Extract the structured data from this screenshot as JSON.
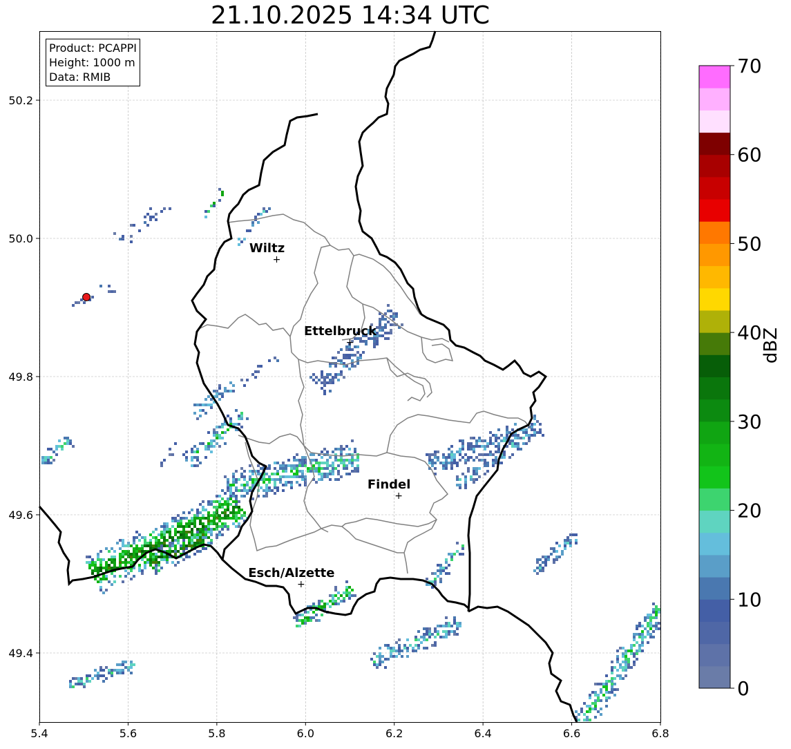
{
  "title": "21.10.2025 14:34 UTC",
  "info_box": {
    "product": "Product: PCAPPI",
    "height": "Height: 1000 m",
    "data": "Data: RMIB"
  },
  "axes": {
    "x_ticks": [
      "5.4",
      "5.6",
      "5.8",
      "6.0",
      "6.2",
      "6.4",
      "6.6",
      "6.8"
    ],
    "y_ticks": [
      "50.2",
      "50.0",
      "49.8",
      "49.6",
      "49.4"
    ],
    "xlim": [
      5.4,
      6.8
    ],
    "ylim": [
      49.3,
      50.3
    ],
    "grid": true
  },
  "cities": [
    {
      "name": "Wiltz",
      "lon": 5.935,
      "lat": 49.97
    },
    {
      "name": "Ettelbruck",
      "lon": 6.1,
      "lat": 49.85
    },
    {
      "name": "Findel",
      "lon": 6.21,
      "lat": 49.628
    },
    {
      "name": "Esch/Alzette",
      "lon": 5.99,
      "lat": 49.5
    }
  ],
  "radar_site": {
    "lon": 5.506,
    "lat": 49.915,
    "color": "#e8191c"
  },
  "colorbar": {
    "label": "dBZ",
    "ticks": [
      "0",
      "10",
      "20",
      "30",
      "40",
      "50",
      "60",
      "70"
    ],
    "range": [
      0,
      70
    ],
    "step": 2.5,
    "colors": [
      "#6a7ca8",
      "#5e72a8",
      "#4f67a6",
      "#445fa6",
      "#4a78b0",
      "#5a9ec8",
      "#64bedc",
      "#5fd4c0",
      "#3dd46f",
      "#12c41a",
      "#12b414",
      "#10a512",
      "#0c8a10",
      "#0a760c",
      "#075e08",
      "#467a08",
      "#afb108",
      "#ffd800",
      "#ffb800",
      "#ff9800",
      "#ff7800",
      "#e80000",
      "#c80000",
      "#a80000",
      "#7e0000",
      "#ffe0ff",
      "#ffb0ff",
      "#ff6cff",
      "#ee30ee"
    ]
  },
  "colors": {
    "border": "#000000",
    "district": "#808080",
    "grid": "#b0b0b0"
  }
}
